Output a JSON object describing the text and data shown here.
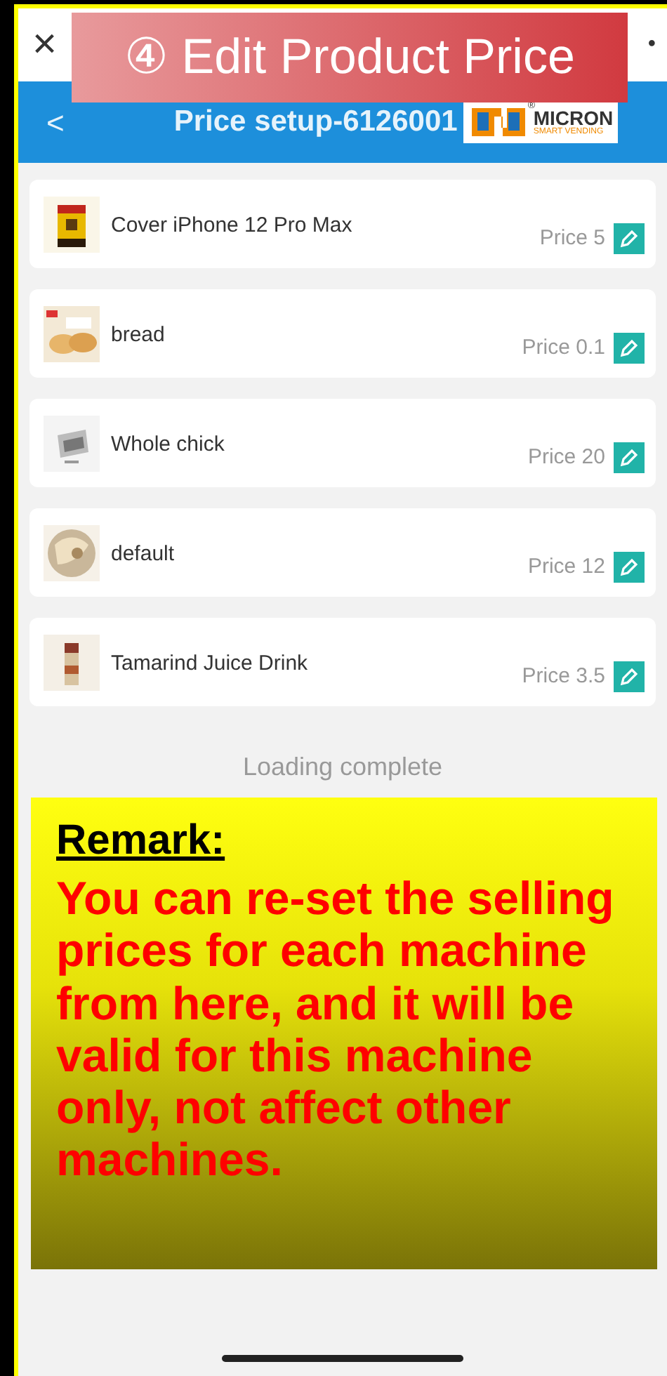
{
  "top_bar": {
    "close": "×",
    "menu": "•"
  },
  "banner": {
    "title": "④ Edit Product Price"
  },
  "header": {
    "back": "<",
    "title": "Price setup-6126001",
    "logo": {
      "brand": "MICRON",
      "tagline": "SMART VENDING",
      "mark": "®"
    }
  },
  "products": [
    {
      "name": "Cover iPhone 12 Pro Max",
      "price": "Price 5",
      "kind": "picture"
    },
    {
      "name": "bread",
      "price": "Price 0.1",
      "kind": "picture"
    },
    {
      "name": "Whole chick",
      "price": "Price 20",
      "kind": "picture"
    },
    {
      "name": "default",
      "price": "Price 12",
      "kind": "picture"
    },
    {
      "name": "Tamarind Juice Drink",
      "price": "Price 3.5",
      "kind": "picture"
    }
  ],
  "footer": "Loading complete",
  "remark": {
    "heading": "Remark:",
    "text": "You can re-set the selling prices for each machine from here, and it will be valid for this machine only, not affect other machines."
  }
}
